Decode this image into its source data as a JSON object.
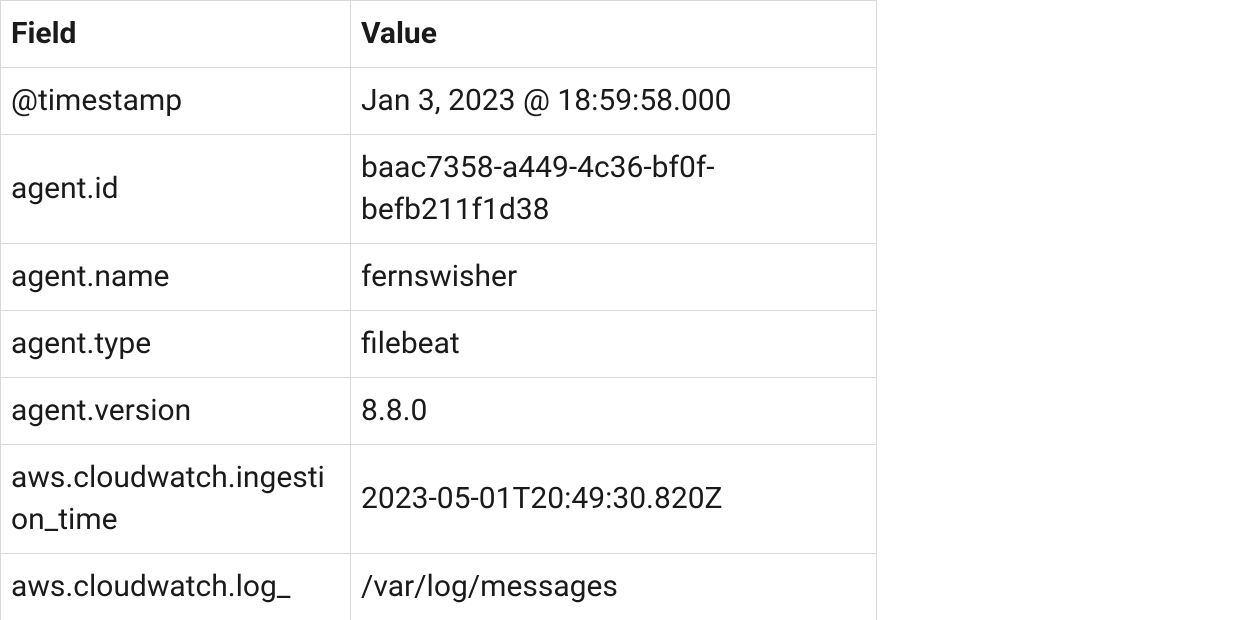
{
  "table": {
    "headers": {
      "field": "Field",
      "value": "Value"
    },
    "rows": [
      {
        "field": "@timestamp",
        "value": "Jan 3, 2023 @ 18:59:58.000"
      },
      {
        "field": "agent.id",
        "value": "baac7358-a449-4c36-bf0f-befb211f1d38"
      },
      {
        "field": "agent.name",
        "value": "fernswisher"
      },
      {
        "field": "agent.type",
        "value": "filebeat"
      },
      {
        "field": "agent.version",
        "value": "8.8.0"
      },
      {
        "field": "aws.cloudwatch.ingestion_time",
        "value": "2023-05-01T20:49:30.820Z"
      },
      {
        "field": "aws.cloudwatch.log_",
        "value": "/var/log/messages"
      }
    ]
  }
}
